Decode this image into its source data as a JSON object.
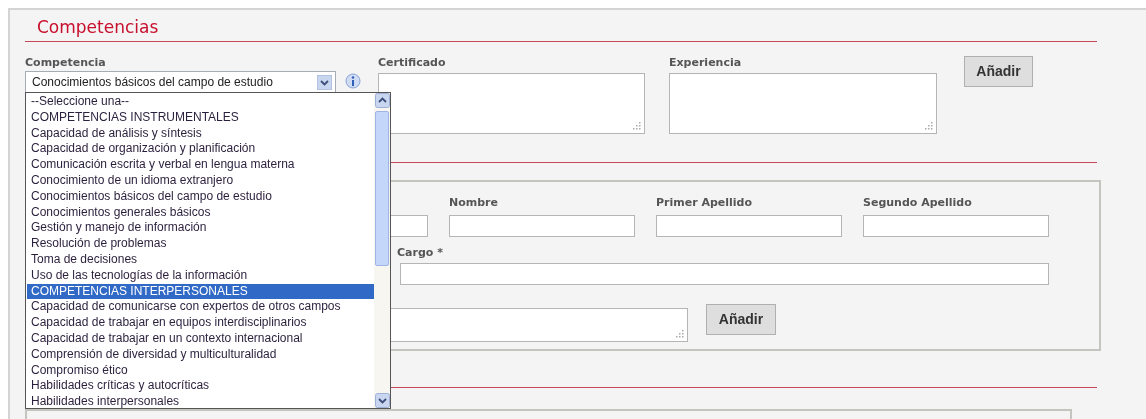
{
  "section_title": "Competencias",
  "competencia": {
    "label": "Competencia",
    "value": "Conocimientos básicos del campo de estudio"
  },
  "certificado": {
    "label": "Certificado"
  },
  "experiencia": {
    "label": "Experiencia"
  },
  "add_button": "Añadir",
  "dropdown_options": [
    {
      "label": "--Seleccione una--",
      "selected": false
    },
    {
      "label": "COMPETENCIAS INSTRUMENTALES",
      "selected": false
    },
    {
      "label": "Capacidad de análisis y síntesis",
      "selected": false
    },
    {
      "label": "Capacidad de organización y planificación",
      "selected": false
    },
    {
      "label": "Comunicación escrita y verbal en lengua materna",
      "selected": false
    },
    {
      "label": "Conocimiento de un idioma extranjero",
      "selected": false
    },
    {
      "label": "Conocimientos básicos del campo de estudio",
      "selected": false
    },
    {
      "label": "Conocimientos generales básicos",
      "selected": false
    },
    {
      "label": "Gestión y manejo de información",
      "selected": false
    },
    {
      "label": "Resolución de problemas",
      "selected": false
    },
    {
      "label": "Toma de decisiones",
      "selected": false
    },
    {
      "label": "Uso de las tecnologías de la información",
      "selected": false
    },
    {
      "label": "COMPETENCIAS INTERPERSONALES",
      "selected": true
    },
    {
      "label": "Capacidad de comunicarse con expertos de otros campos",
      "selected": false
    },
    {
      "label": "Capacidad de trabajar en equipos interdisciplinarios",
      "selected": false
    },
    {
      "label": "Capacidad de trabajar en un contexto internacional",
      "selected": false
    },
    {
      "label": "Comprensión de diversidad y multiculturalidad",
      "selected": false
    },
    {
      "label": "Compromiso ético",
      "selected": false
    },
    {
      "label": "Habilidades críticas y autocríticas",
      "selected": false
    },
    {
      "label": "Habilidades interpersonales",
      "selected": false
    }
  ],
  "contact_fields": [
    {
      "label": "Nombre"
    },
    {
      "label": "Primer Apellido"
    },
    {
      "label": "Segundo Apellido"
    }
  ],
  "cargo": {
    "label": "Cargo *"
  },
  "contact_add_button": "Añadir"
}
